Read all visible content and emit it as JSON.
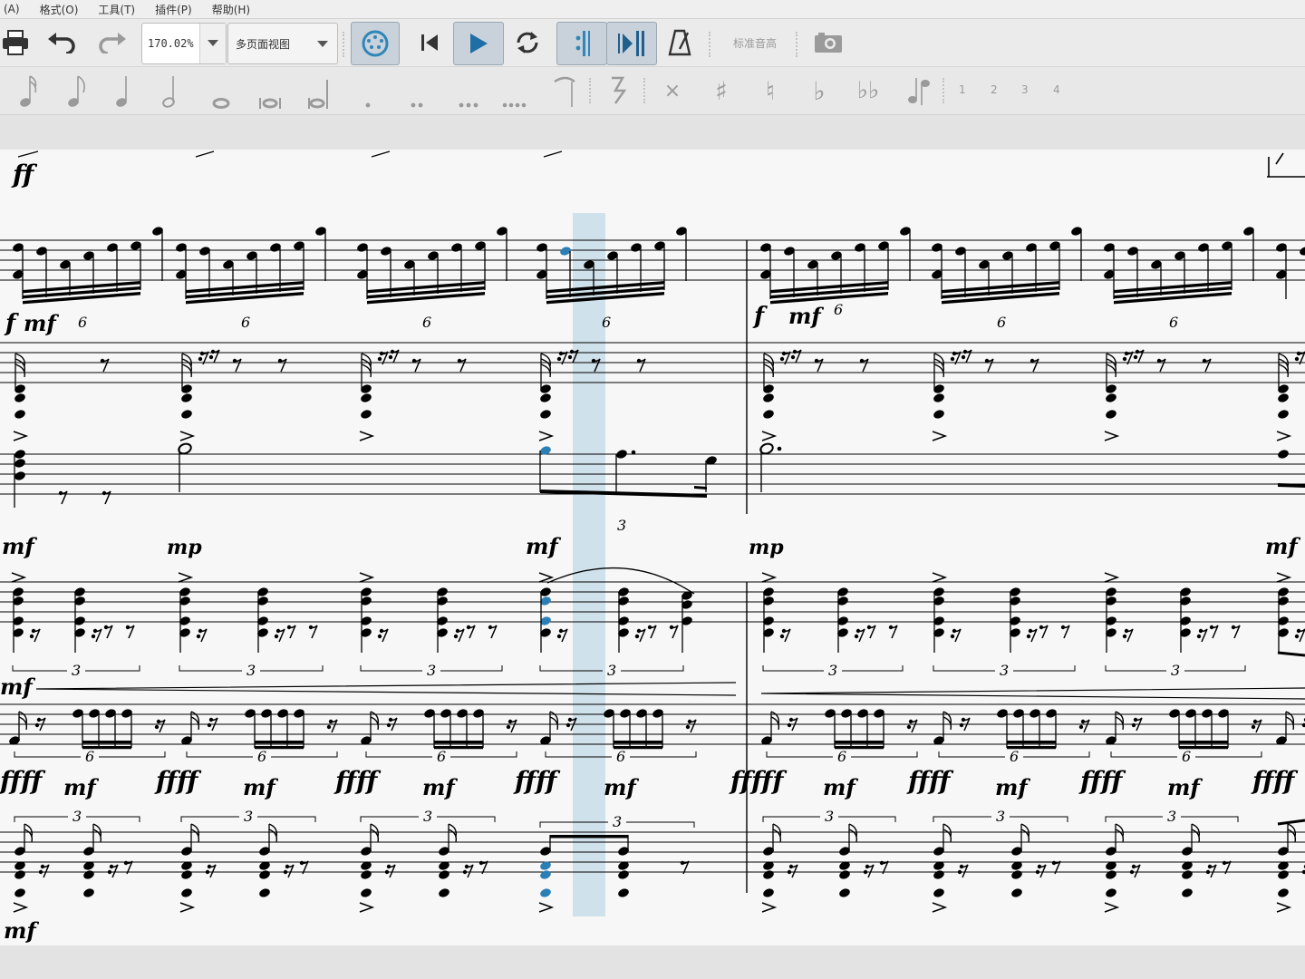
{
  "menu": {
    "items": [
      "(A)",
      "格式(O)",
      "工具(T)",
      "插件(P)",
      "帮助(H)"
    ]
  },
  "toolbar": {
    "zoom_value": "170.02%",
    "view_mode": "多页面视图",
    "concert_pitch_label": "标准音高",
    "play_pressed": true,
    "loop_in_pressed": true,
    "loop_out_pressed": true
  },
  "palette": {
    "voices": [
      "1",
      "2",
      "3",
      "4"
    ]
  },
  "colors": {
    "selection": "#2b7fb5",
    "highlight": "#cfe1ea",
    "ink": "#000000"
  },
  "score": {
    "tuplets": {
      "six": "6",
      "three": "3"
    },
    "dynamics": {
      "ff": "ff",
      "f": "f",
      "mf": "mf",
      "mp": "mp",
      "ffff": "ffff",
      "fffff": "fffff"
    }
  }
}
